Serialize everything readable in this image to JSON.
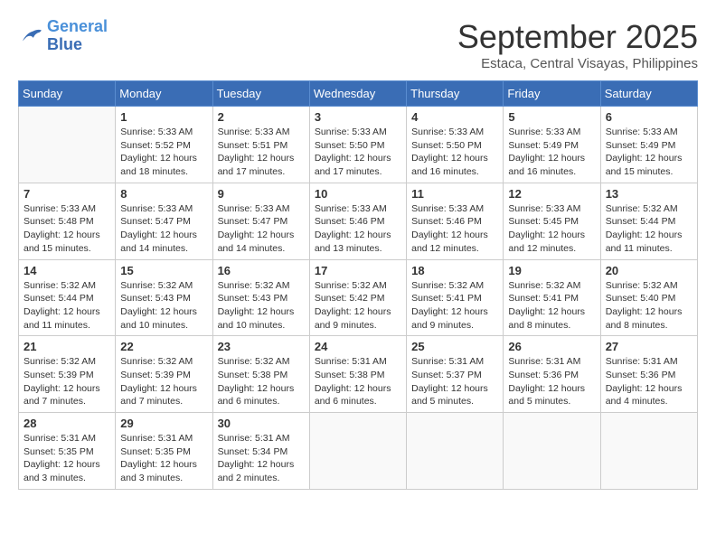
{
  "header": {
    "logo_general": "General",
    "logo_blue": "Blue",
    "month_title": "September 2025",
    "location": "Estaca, Central Visayas, Philippines"
  },
  "days_of_week": [
    "Sunday",
    "Monday",
    "Tuesday",
    "Wednesday",
    "Thursday",
    "Friday",
    "Saturday"
  ],
  "weeks": [
    [
      {
        "day": "",
        "info": ""
      },
      {
        "day": "1",
        "info": "Sunrise: 5:33 AM\nSunset: 5:52 PM\nDaylight: 12 hours\nand 18 minutes."
      },
      {
        "day": "2",
        "info": "Sunrise: 5:33 AM\nSunset: 5:51 PM\nDaylight: 12 hours\nand 17 minutes."
      },
      {
        "day": "3",
        "info": "Sunrise: 5:33 AM\nSunset: 5:50 PM\nDaylight: 12 hours\nand 17 minutes."
      },
      {
        "day": "4",
        "info": "Sunrise: 5:33 AM\nSunset: 5:50 PM\nDaylight: 12 hours\nand 16 minutes."
      },
      {
        "day": "5",
        "info": "Sunrise: 5:33 AM\nSunset: 5:49 PM\nDaylight: 12 hours\nand 16 minutes."
      },
      {
        "day": "6",
        "info": "Sunrise: 5:33 AM\nSunset: 5:49 PM\nDaylight: 12 hours\nand 15 minutes."
      }
    ],
    [
      {
        "day": "7",
        "info": "Sunrise: 5:33 AM\nSunset: 5:48 PM\nDaylight: 12 hours\nand 15 minutes."
      },
      {
        "day": "8",
        "info": "Sunrise: 5:33 AM\nSunset: 5:47 PM\nDaylight: 12 hours\nand 14 minutes."
      },
      {
        "day": "9",
        "info": "Sunrise: 5:33 AM\nSunset: 5:47 PM\nDaylight: 12 hours\nand 14 minutes."
      },
      {
        "day": "10",
        "info": "Sunrise: 5:33 AM\nSunset: 5:46 PM\nDaylight: 12 hours\nand 13 minutes."
      },
      {
        "day": "11",
        "info": "Sunrise: 5:33 AM\nSunset: 5:46 PM\nDaylight: 12 hours\nand 12 minutes."
      },
      {
        "day": "12",
        "info": "Sunrise: 5:33 AM\nSunset: 5:45 PM\nDaylight: 12 hours\nand 12 minutes."
      },
      {
        "day": "13",
        "info": "Sunrise: 5:32 AM\nSunset: 5:44 PM\nDaylight: 12 hours\nand 11 minutes."
      }
    ],
    [
      {
        "day": "14",
        "info": "Sunrise: 5:32 AM\nSunset: 5:44 PM\nDaylight: 12 hours\nand 11 minutes."
      },
      {
        "day": "15",
        "info": "Sunrise: 5:32 AM\nSunset: 5:43 PM\nDaylight: 12 hours\nand 10 minutes."
      },
      {
        "day": "16",
        "info": "Sunrise: 5:32 AM\nSunset: 5:43 PM\nDaylight: 12 hours\nand 10 minutes."
      },
      {
        "day": "17",
        "info": "Sunrise: 5:32 AM\nSunset: 5:42 PM\nDaylight: 12 hours\nand 9 minutes."
      },
      {
        "day": "18",
        "info": "Sunrise: 5:32 AM\nSunset: 5:41 PM\nDaylight: 12 hours\nand 9 minutes."
      },
      {
        "day": "19",
        "info": "Sunrise: 5:32 AM\nSunset: 5:41 PM\nDaylight: 12 hours\nand 8 minutes."
      },
      {
        "day": "20",
        "info": "Sunrise: 5:32 AM\nSunset: 5:40 PM\nDaylight: 12 hours\nand 8 minutes."
      }
    ],
    [
      {
        "day": "21",
        "info": "Sunrise: 5:32 AM\nSunset: 5:39 PM\nDaylight: 12 hours\nand 7 minutes."
      },
      {
        "day": "22",
        "info": "Sunrise: 5:32 AM\nSunset: 5:39 PM\nDaylight: 12 hours\nand 7 minutes."
      },
      {
        "day": "23",
        "info": "Sunrise: 5:32 AM\nSunset: 5:38 PM\nDaylight: 12 hours\nand 6 minutes."
      },
      {
        "day": "24",
        "info": "Sunrise: 5:31 AM\nSunset: 5:38 PM\nDaylight: 12 hours\nand 6 minutes."
      },
      {
        "day": "25",
        "info": "Sunrise: 5:31 AM\nSunset: 5:37 PM\nDaylight: 12 hours\nand 5 minutes."
      },
      {
        "day": "26",
        "info": "Sunrise: 5:31 AM\nSunset: 5:36 PM\nDaylight: 12 hours\nand 5 minutes."
      },
      {
        "day": "27",
        "info": "Sunrise: 5:31 AM\nSunset: 5:36 PM\nDaylight: 12 hours\nand 4 minutes."
      }
    ],
    [
      {
        "day": "28",
        "info": "Sunrise: 5:31 AM\nSunset: 5:35 PM\nDaylight: 12 hours\nand 3 minutes."
      },
      {
        "day": "29",
        "info": "Sunrise: 5:31 AM\nSunset: 5:35 PM\nDaylight: 12 hours\nand 3 minutes."
      },
      {
        "day": "30",
        "info": "Sunrise: 5:31 AM\nSunset: 5:34 PM\nDaylight: 12 hours\nand 2 minutes."
      },
      {
        "day": "",
        "info": ""
      },
      {
        "day": "",
        "info": ""
      },
      {
        "day": "",
        "info": ""
      },
      {
        "day": "",
        "info": ""
      }
    ]
  ]
}
